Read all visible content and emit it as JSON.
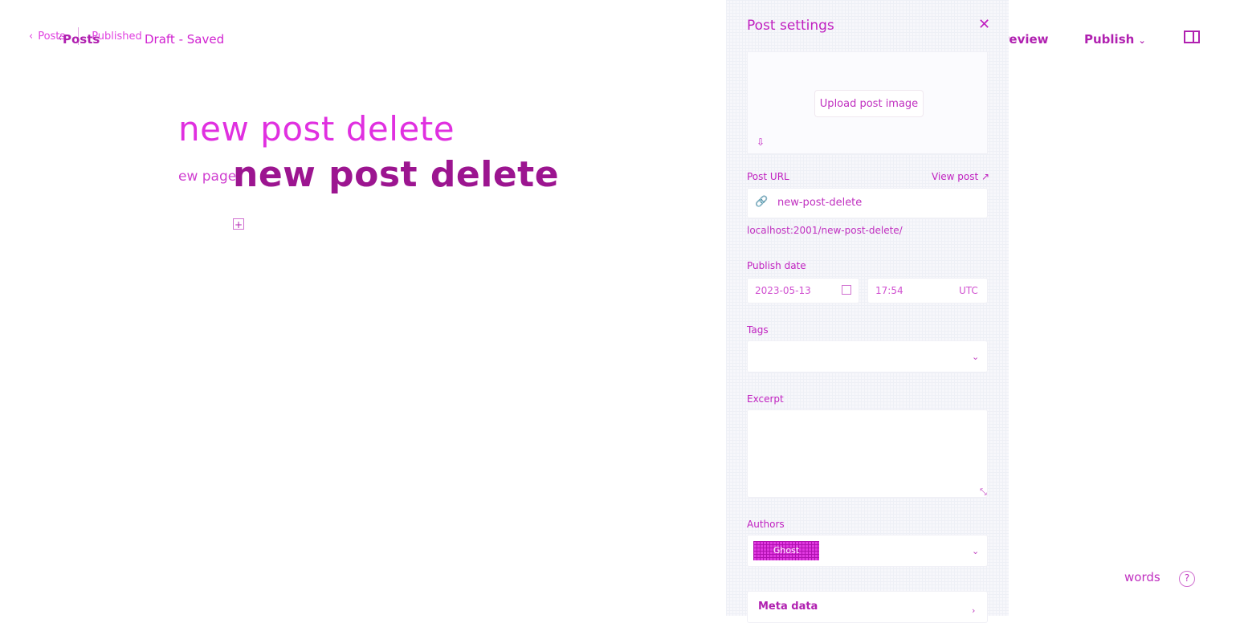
{
  "ghost_nav": {
    "back": "Posts",
    "status": "Published"
  },
  "topbar": {
    "back_label": "Posts",
    "status": "Draft - Saved",
    "preview_label": "Preview",
    "publish_label": "Publish"
  },
  "editor": {
    "title_ghost": "new post delete",
    "subtitle_ghost": "ew page",
    "title": "new post delete"
  },
  "footer": {
    "word_count_label": "words",
    "help_icon": "?"
  },
  "settings": {
    "title": "Post settings",
    "upload_image_label": "Upload post image",
    "post_url_label": "Post URL",
    "view_post_label": "View post",
    "slug": "new-post-delete",
    "url_hint": "localhost:2001/new-post-delete/",
    "publish_date_label": "Publish date",
    "date": "2023-05-13",
    "time": "17:54",
    "timezone": "UTC",
    "tags_label": "Tags",
    "excerpt_label": "Excerpt",
    "authors_label": "Authors",
    "author": "Ghost",
    "meta_label": "Meta data"
  },
  "colors": {
    "accent": "#b020b0",
    "sidebar_bg": "#f7f7fb"
  }
}
